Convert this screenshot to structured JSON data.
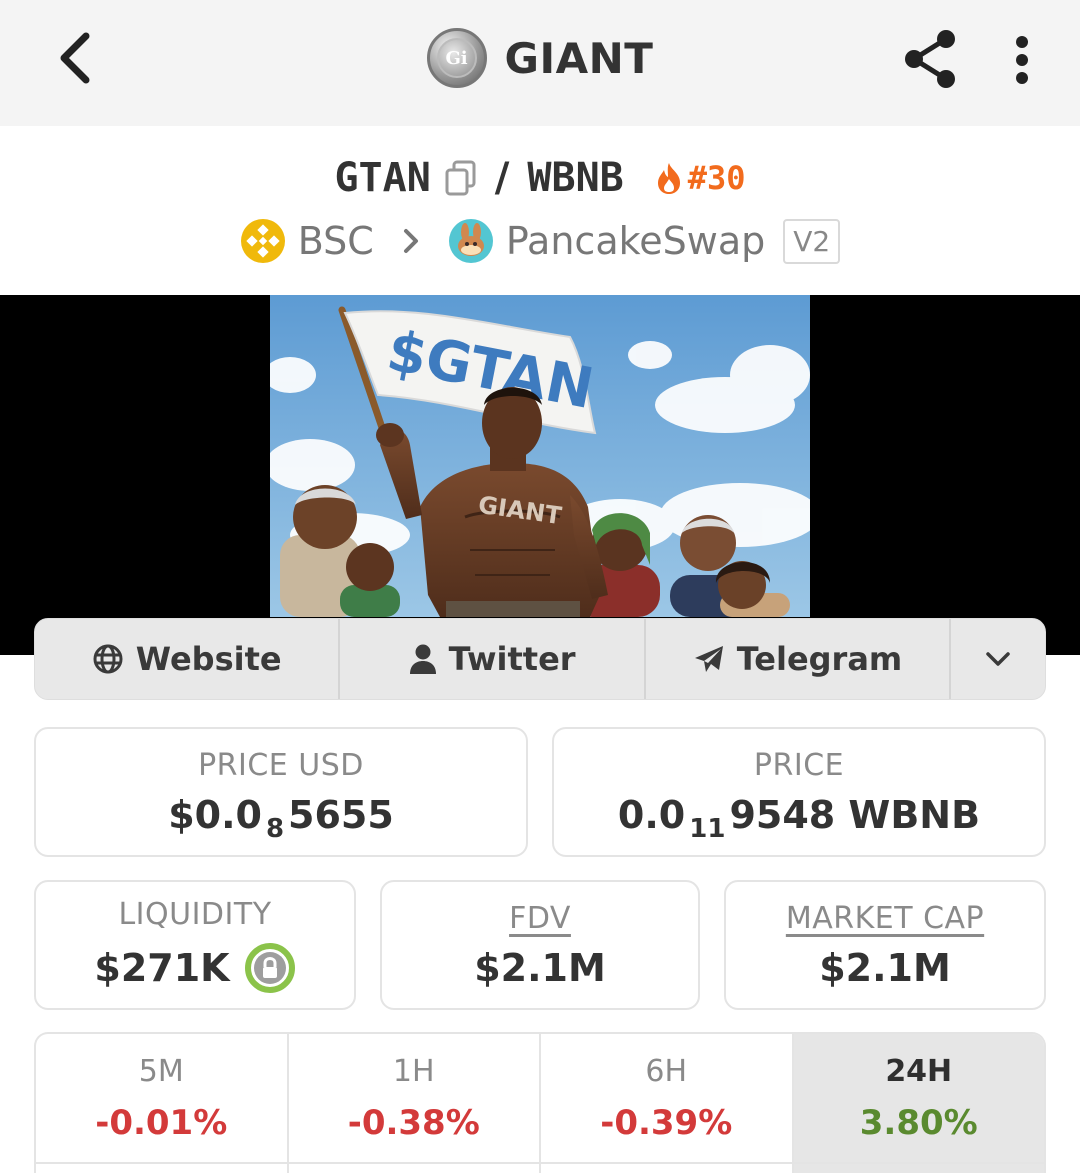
{
  "appbar": {
    "title": "GIANT",
    "logo_text": "Gi"
  },
  "pair": {
    "base": "GTAN",
    "separator": "/",
    "quote": "WBNB",
    "rank": "#30"
  },
  "chain": {
    "name": "BSC",
    "dex": "PancakeSwap",
    "version": "V2"
  },
  "banner": {
    "flag_text": "$GTAN",
    "shirt_text": "GIANT"
  },
  "links": [
    {
      "label": "Website",
      "icon": "globe-icon"
    },
    {
      "label": "Twitter",
      "icon": "user-icon"
    },
    {
      "label": "Telegram",
      "icon": "paper-plane-icon"
    }
  ],
  "stats": {
    "price_usd": {
      "label": "PRICE USD",
      "prefix": "$0.0",
      "sub": "8",
      "suffix": "5655"
    },
    "price": {
      "label": "PRICE",
      "prefix": "0.0",
      "sub": "11",
      "suffix": "9548 WBNB"
    },
    "liquidity": {
      "label": "LIQUIDITY",
      "value": "$271K"
    },
    "fdv": {
      "label": "FDV",
      "value": "$2.1M"
    },
    "market_cap": {
      "label": "MARKET CAP",
      "value": "$2.1M"
    }
  },
  "changes": [
    {
      "label": "5M",
      "value": "-0.01%"
    },
    {
      "label": "1H",
      "value": "-0.38%"
    },
    {
      "label": "6H",
      "value": "-0.39%"
    },
    {
      "label": "24H",
      "value": "3.80%"
    }
  ],
  "colors": {
    "negative": "#d33a3a",
    "positive": "#5a8a2f",
    "rank": "#f26b1d",
    "bnb": "#f0b90b",
    "cake": "#53c6d2"
  }
}
